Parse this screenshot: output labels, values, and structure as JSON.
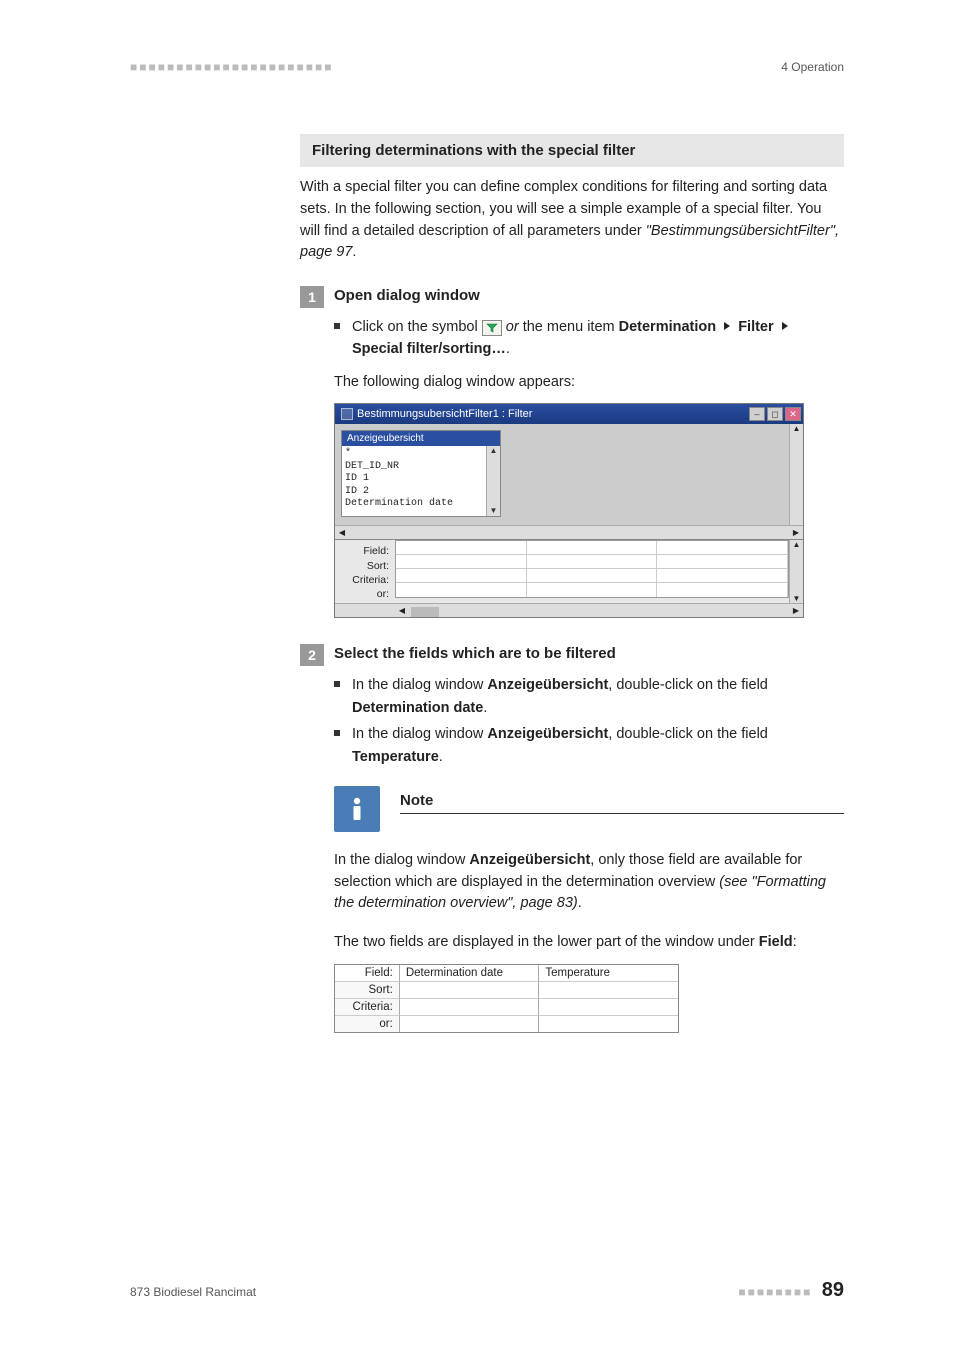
{
  "header": {
    "dots": "■■■■■■■■■■■■■■■■■■■■■■",
    "right": "4 Operation"
  },
  "section_title": "Filtering determinations with the special filter",
  "intro": "With a special filter you can define complex conditions for filtering and sorting data sets. In the following section, you will see a simple example of a special filter. You will find a detailed description of all parameters under ",
  "intro_ref": "\"BestimmungsübersichtFilter\", page 97",
  "intro_tail": ".",
  "step1": {
    "num": "1",
    "title": "Open dialog window",
    "bullet_pre": "Click on the symbol ",
    "bullet_mid_italic": "or",
    "bullet_post": " the menu item ",
    "menu1": "Determination",
    "menu2": "Filter",
    "menu3": "Special filter/sorting…",
    "tail": ".",
    "after": "The following dialog window appears:"
  },
  "dialog1": {
    "title": "BestimmungsubersichtFilter1 : Filter",
    "listbox_header": "Anzeigeubersicht",
    "listbox_items": [
      "*",
      "DET_ID_NR",
      "ID 1",
      "ID 2",
      "Determination date"
    ],
    "labels_list": [
      "Field:",
      "Sort:",
      "Criteria:",
      "or:"
    ]
  },
  "step2": {
    "num": "2",
    "title": "Select the fields which are to be filtered",
    "b1_pre": "In the dialog window ",
    "b1_win": "Anzeigeübersicht",
    "b1_mid": ", double-click on the field ",
    "b1_field": "Determination date",
    "b2_pre": "In the dialog window ",
    "b2_win": "Anzeigeübersicht",
    "b2_mid": ", double-click on the field ",
    "b2_field": "Temperature"
  },
  "note": {
    "title": "Note",
    "body_pre": "In the dialog window ",
    "body_win": "Anzeigeübersicht",
    "body_mid": ", only those field are available for selection which are displayed in the determination overview ",
    "body_ref": "(see \"Formatting the determination overview\", page 83)",
    "body_tail": "."
  },
  "after_note": {
    "pre": "The two fields are displayed in the lower part of the window under ",
    "bold": "Field",
    "tail": ":"
  },
  "grid2": {
    "labels": [
      "Field:",
      "Sort:",
      "Criteria:",
      "or:"
    ],
    "col1": "Determination date",
    "col2": "Temperature"
  },
  "footer": {
    "left": "873 Biodiesel Rancimat",
    "fdots": "■■■■■■■■",
    "page": "89"
  }
}
